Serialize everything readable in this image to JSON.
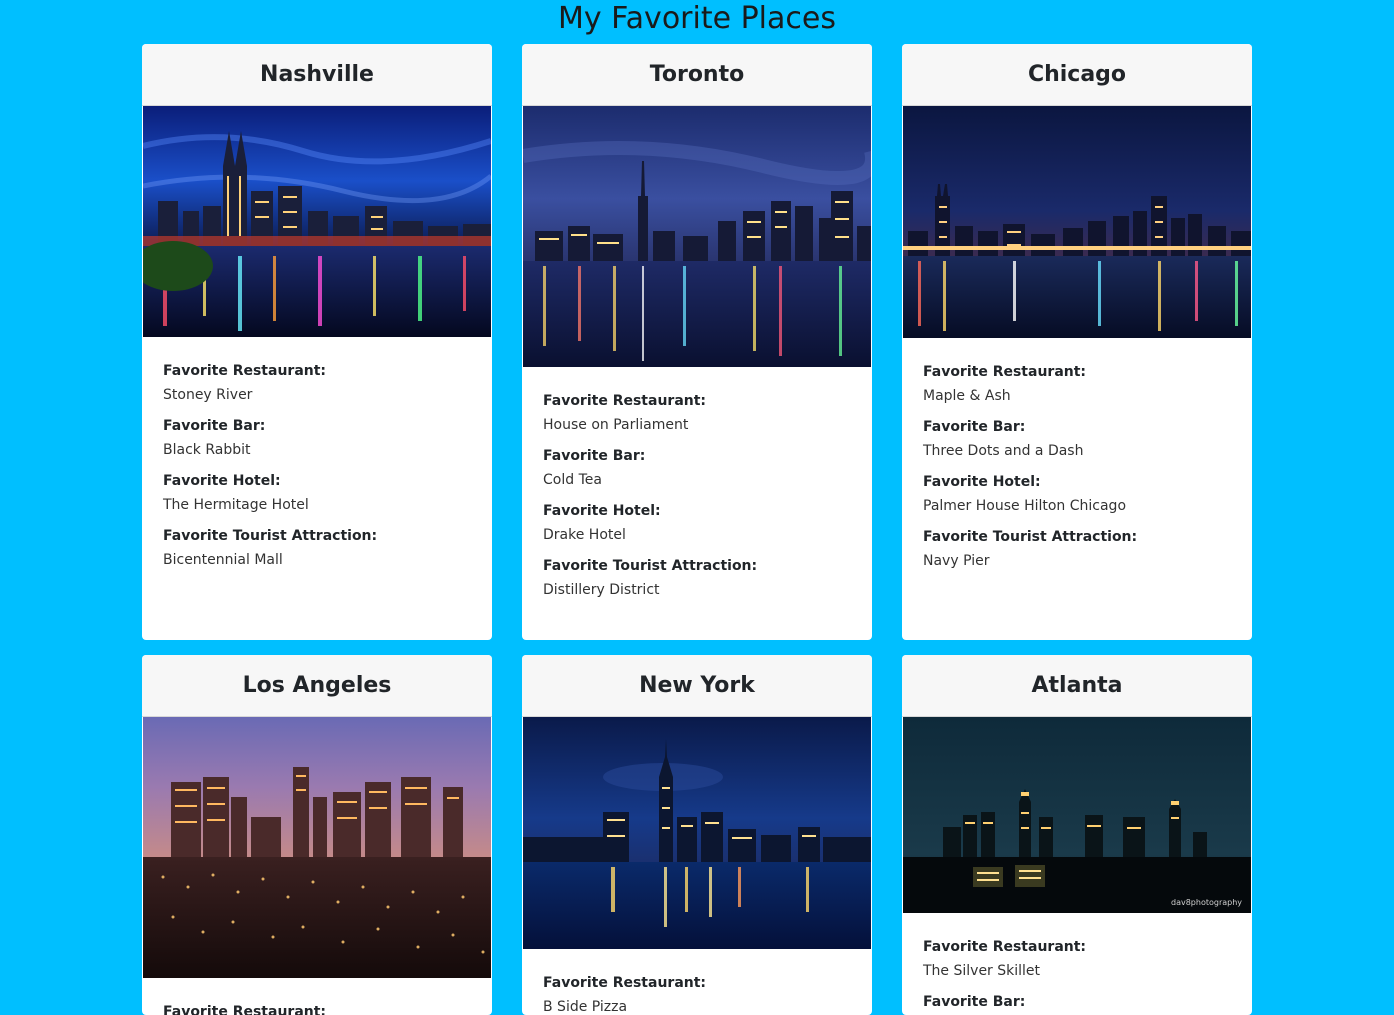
{
  "page": {
    "title": "My Favorite Places"
  },
  "labels": {
    "restaurant": "Favorite Restaurant:",
    "bar": "Favorite Bar:",
    "hotel": "Favorite Hotel:",
    "attraction": "Favorite Tourist Attraction:"
  },
  "cities": [
    {
      "name": "Nashville",
      "restaurant": "Stoney River",
      "bar": "Black Rabbit",
      "hotel": "The Hermitage Hotel",
      "attraction": "Bicentennial Mall",
      "photo": "nashville-skyline-night"
    },
    {
      "name": "Toronto",
      "restaurant": "House on Parliament",
      "bar": "Cold Tea",
      "hotel": "Drake Hotel",
      "attraction": "Distillery District",
      "photo": "toronto-skyline-night"
    },
    {
      "name": "Chicago",
      "restaurant": "Maple & Ash",
      "bar": "Three Dots and a Dash",
      "hotel": "Palmer House Hilton Chicago",
      "attraction": "Navy Pier",
      "photo": "chicago-skyline-night"
    },
    {
      "name": "Los Angeles",
      "restaurant": "Favorite Restaurant:",
      "photo": "los-angeles-skyline-dusk"
    },
    {
      "name": "New York",
      "restaurant": "B Side Pizza",
      "photo": "new-york-skyline-night"
    },
    {
      "name": "Atlanta",
      "restaurant": "The Silver Skillet",
      "photo": "atlanta-skyline-night",
      "photo_watermark": "dav8photography"
    }
  ],
  "colors": {
    "background": "#00bfff",
    "card": "#ffffff",
    "card_header": "#f7f7f7"
  }
}
